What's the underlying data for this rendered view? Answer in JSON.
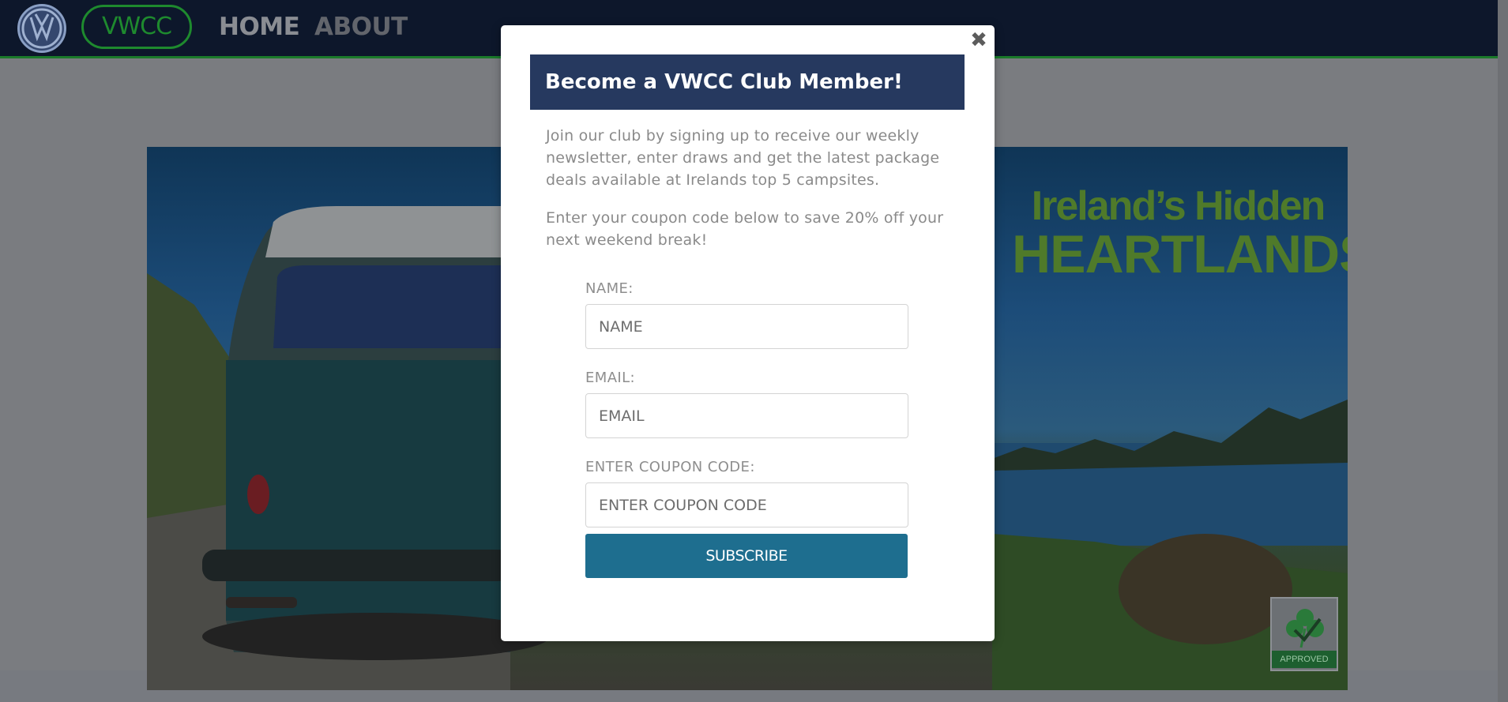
{
  "navbar": {
    "brand": "VWCC",
    "links": [
      "HOME",
      "ABOUT"
    ]
  },
  "hero": {
    "title_line1": "Ireland’s Hidden",
    "title_line2": "HEARTLANDS",
    "badge_label": "APPROVED"
  },
  "modal": {
    "close_glyph": "✖",
    "title": "Become a VWCC Club Member!",
    "intro": "Join our club by signing up to receive our weekly newsletter, enter draws and get the latest package deals available at Irelands top 5 campsites.",
    "coupon_text": "Enter your coupon code below to save 20% off your next weekend break!",
    "fields": [
      {
        "label": "NAME:",
        "placeholder": "NAME"
      },
      {
        "label": "EMAIL:",
        "placeholder": "EMAIL"
      },
      {
        "label": "ENTER COUPON CODE:",
        "placeholder": "ENTER COUPON CODE"
      }
    ],
    "submit_label": "SUBSCRIBE"
  },
  "colors": {
    "navbar_bg": "#0d172b",
    "brand_green": "#1e8a2e",
    "modal_header_bg": "#26395f",
    "button_bg": "#1e6e8f",
    "overlay": "#777a80"
  },
  "icons": {
    "logo": "vw-logo-icon",
    "close": "close-icon",
    "badge": "shamrock-icon"
  }
}
